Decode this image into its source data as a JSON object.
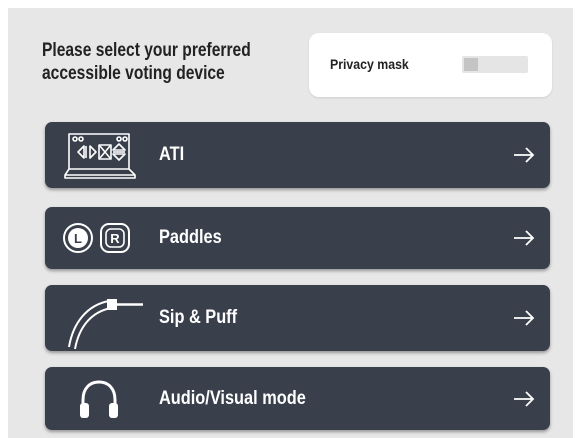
{
  "header": {
    "title_line1": "Please select your preferred",
    "title_line2": "accessible voting device"
  },
  "privacy": {
    "label": "Privacy mask",
    "enabled": false
  },
  "devices": [
    {
      "label": "ATI",
      "icon": "ati-keypad-icon"
    },
    {
      "label": "Paddles",
      "icon": "paddles-icon"
    },
    {
      "label": "Sip & Puff",
      "icon": "sip-puff-icon"
    },
    {
      "label": "Audio/Visual mode",
      "icon": "headphones-icon"
    }
  ],
  "colors": {
    "background": "#e7e7e7",
    "button": "#393f4b",
    "button_text": "#ffffff",
    "card": "#ffffff"
  }
}
